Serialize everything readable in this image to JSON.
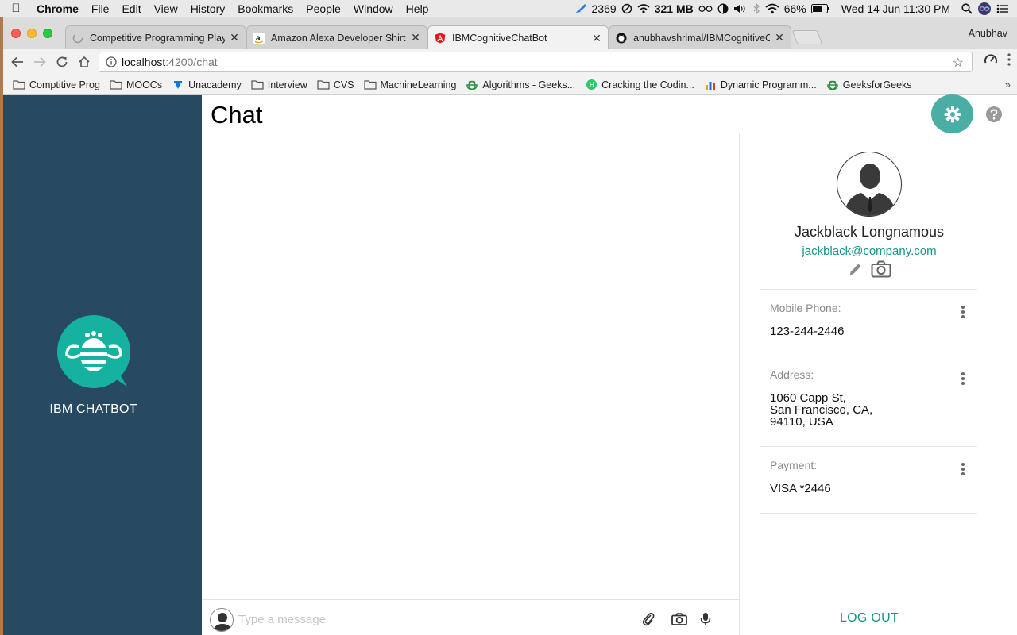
{
  "menubar": {
    "app": "Chrome",
    "items": [
      "File",
      "Edit",
      "View",
      "History",
      "Bookmarks",
      "People",
      "Window",
      "Help"
    ],
    "status": {
      "count": "2369",
      "memory": "321 MB",
      "battery": "66%",
      "datetime": "Wed 14 Jun  11:30 PM"
    }
  },
  "browser": {
    "tabs": [
      {
        "title": "Competitive Programming Play",
        "active": false
      },
      {
        "title": "Amazon Alexa Developer Shirt",
        "active": false
      },
      {
        "title": "IBMCognitiveChatBot",
        "active": true
      },
      {
        "title": "anubhavshrimal/IBMCognitiveC",
        "active": false
      }
    ],
    "profile": "Anubhav",
    "url_host": "localhost",
    "url_path": ":4200/chat",
    "bookmarks": [
      {
        "label": "Comptitive Prog",
        "icon": "folder-icon"
      },
      {
        "label": "MOOCs",
        "icon": "folder-icon"
      },
      {
        "label": "Unacademy",
        "icon": "unacademy-icon"
      },
      {
        "label": "Interview",
        "icon": "folder-icon"
      },
      {
        "label": "CVS",
        "icon": "folder-icon"
      },
      {
        "label": "MachineLearning",
        "icon": "folder-icon"
      },
      {
        "label": "Algorithms - Geeks...",
        "icon": "geeksforgeeks-icon"
      },
      {
        "label": "Cracking the Codin...",
        "icon": "hackerrank-icon"
      },
      {
        "label": "Dynamic Programm...",
        "icon": "chart-icon"
      },
      {
        "label": "GeeksforGeeks",
        "icon": "geeksforgeeks-icon"
      }
    ]
  },
  "app": {
    "brand": "IBM CHATBOT",
    "title": "Chat",
    "accent": "#4aaea4",
    "sidebar_color": "#274a61",
    "link_color": "#17938a",
    "composer": {
      "placeholder": "Type a message"
    },
    "profile": {
      "name": "Jackblack Longnamous",
      "email": "jackblack@company.com",
      "fields": [
        {
          "label": "Mobile Phone:",
          "value": "123-244-2446"
        },
        {
          "label": "Address:",
          "value": "1060 Capp St,\nSan Francisco, CA,\n94110, USA"
        },
        {
          "label": "Payment:",
          "value": "VISA *2446"
        }
      ],
      "logout": "LOG OUT"
    }
  }
}
